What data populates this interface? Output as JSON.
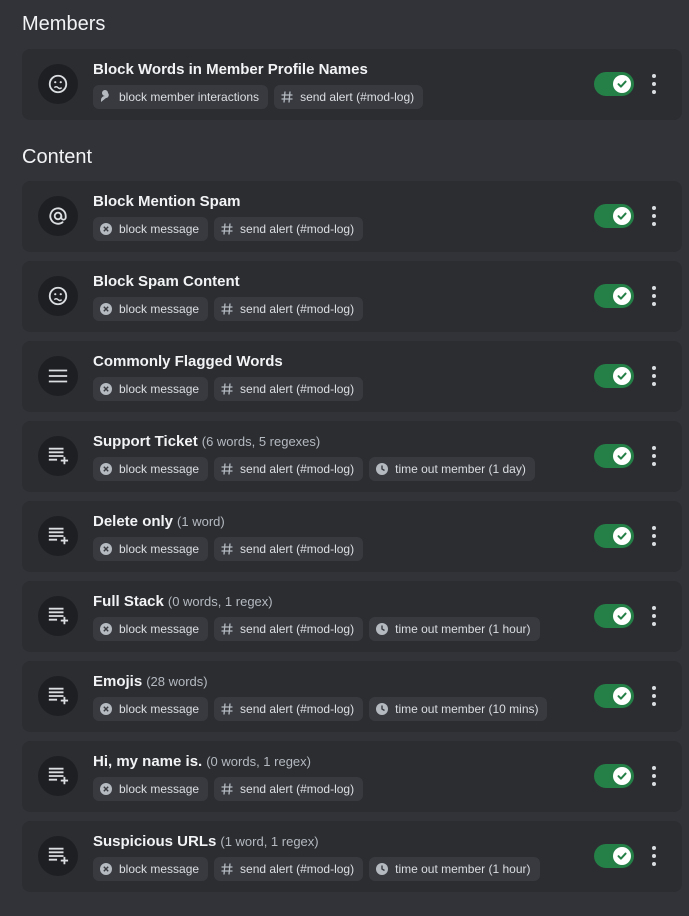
{
  "sections": [
    {
      "title": "Members",
      "rules": [
        {
          "icon": "emoji-face-icon",
          "title": "Block Words in Member Profile Names",
          "subtitle": "",
          "enabled": true,
          "actions": [
            {
              "icon": "member-interaction-icon",
              "label": "block member interactions"
            },
            {
              "icon": "hash-icon",
              "label": "send alert (#mod-log)"
            }
          ]
        }
      ]
    },
    {
      "title": "Content",
      "rules": [
        {
          "icon": "at-sign-icon",
          "title": "Block Mention Spam",
          "subtitle": "",
          "enabled": true,
          "actions": [
            {
              "icon": "block-x-icon",
              "label": "block message"
            },
            {
              "icon": "hash-icon",
              "label": "send alert (#mod-log)"
            }
          ]
        },
        {
          "icon": "emoji-face-icon",
          "title": "Block Spam Content",
          "subtitle": "",
          "enabled": true,
          "actions": [
            {
              "icon": "block-x-icon",
              "label": "block message"
            },
            {
              "icon": "hash-icon",
              "label": "send alert (#mod-log)"
            }
          ]
        },
        {
          "icon": "list-icon",
          "title": "Commonly Flagged Words",
          "subtitle": "",
          "enabled": true,
          "actions": [
            {
              "icon": "block-x-icon",
              "label": "block message"
            },
            {
              "icon": "hash-icon",
              "label": "send alert (#mod-log)"
            }
          ]
        },
        {
          "icon": "list-add-icon",
          "title": "Support Ticket",
          "subtitle": "(6 words, 5 regexes)",
          "enabled": true,
          "actions": [
            {
              "icon": "block-x-icon",
              "label": "block message"
            },
            {
              "icon": "hash-icon",
              "label": "send alert (#mod-log)"
            },
            {
              "icon": "timeout-clock-icon",
              "label": "time out member (1 day)"
            }
          ]
        },
        {
          "icon": "list-add-icon",
          "title": "Delete only",
          "subtitle": "(1 word)",
          "enabled": true,
          "actions": [
            {
              "icon": "block-x-icon",
              "label": "block message"
            },
            {
              "icon": "hash-icon",
              "label": "send alert (#mod-log)"
            }
          ]
        },
        {
          "icon": "list-add-icon",
          "title": "Full Stack",
          "subtitle": "(0 words, 1 regex)",
          "enabled": true,
          "actions": [
            {
              "icon": "block-x-icon",
              "label": "block message"
            },
            {
              "icon": "hash-icon",
              "label": "send alert (#mod-log)"
            },
            {
              "icon": "timeout-clock-icon",
              "label": "time out member (1 hour)"
            }
          ]
        },
        {
          "icon": "list-add-icon",
          "title": "Emojis",
          "subtitle": "(28 words)",
          "enabled": true,
          "actions": [
            {
              "icon": "block-x-icon",
              "label": "block message"
            },
            {
              "icon": "hash-icon",
              "label": "send alert (#mod-log)"
            },
            {
              "icon": "timeout-clock-icon",
              "label": "time out member (10 mins)"
            }
          ]
        },
        {
          "icon": "list-add-icon",
          "title": "Hi, my name is.",
          "subtitle": "(0 words, 1 regex)",
          "enabled": true,
          "actions": [
            {
              "icon": "block-x-icon",
              "label": "block message"
            },
            {
              "icon": "hash-icon",
              "label": "send alert (#mod-log)"
            }
          ]
        },
        {
          "icon": "list-add-icon",
          "title": "Suspicious URLs",
          "subtitle": "(1 word, 1 regex)",
          "enabled": true,
          "actions": [
            {
              "icon": "block-x-icon",
              "label": "block message"
            },
            {
              "icon": "hash-icon",
              "label": "send alert (#mod-log)"
            },
            {
              "icon": "timeout-clock-icon",
              "label": "time out member (1 hour)"
            }
          ]
        }
      ]
    }
  ],
  "colors": {
    "background": "#313338",
    "card": "#2b2d31",
    "chip": "#383a40",
    "toggle_on": "#248046",
    "text": "#f2f3f5",
    "muted": "#b5bac1"
  }
}
